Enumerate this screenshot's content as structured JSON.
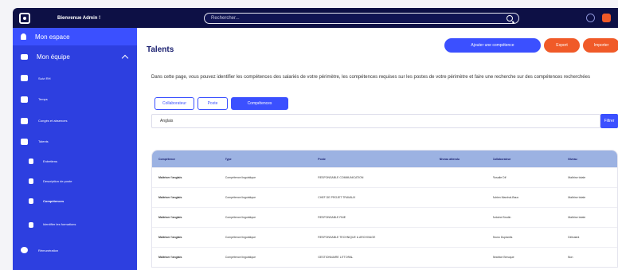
{
  "topbar": {
    "welcome": "Bienvenue Admin !",
    "search_placeholder": "Rechercher..."
  },
  "sidebar": {
    "my_space": "Mon espace",
    "my_team": "Mon équipe",
    "items": [
      {
        "label": "Suivi RH",
        "icon": "chart-icon"
      },
      {
        "label": "Temps",
        "icon": "car-icon"
      },
      {
        "label": "Congés et absences",
        "icon": "calendar-icon"
      },
      {
        "label": "Talents",
        "icon": "graduation-cap-icon"
      }
    ],
    "sub_items": [
      {
        "label": "Entretiens",
        "icon": "person-icon"
      },
      {
        "label": "Description de poste",
        "icon": "briefcase-icon"
      },
      {
        "label": "Compétences",
        "icon": "badge-icon",
        "active": true
      },
      {
        "label": "Identifier les formations",
        "icon": "star-icon"
      }
    ],
    "bottom_item": {
      "label": "Rémunération",
      "icon": "money-icon"
    }
  },
  "main": {
    "title": "Talents",
    "buttons": {
      "add": "Ajouter une compétence",
      "export": "Export",
      "import": "Importer"
    },
    "description": "Dans cette page, vous pouvez identifier les compétences des salariés de votre périmètre, les compétences requises sur les postes de votre périmètre et faire une recherche sur des compétences recherchées",
    "tabs": [
      "Collaborateur",
      "Poste",
      "Compétences"
    ],
    "search_value": "Anglais",
    "filter_label": "Filtrer"
  },
  "table": {
    "headers": [
      "Compétence",
      "Type",
      "Poste",
      "Niveau attendu",
      "Collaborateur",
      "Niveau"
    ],
    "rows": [
      [
        "Maîtriser l'anglais",
        "Compétence linguistique",
        "RESPONSABLE COMMUNICATION",
        "",
        "Rosalie Dif",
        "Maîtrise totale"
      ],
      [
        "Maîtriser l'anglais",
        "Compétence linguistique",
        "CHEF DE PROJET TRAVAUX",
        "",
        "Adrien Marchal-Bauc",
        "Maîtrise totale"
      ],
      [
        "Maîtriser l'anglais",
        "Compétence linguistique",
        "RESPONSABLE PAIE",
        "",
        "Antoine Brodin",
        "Maîtrise totale"
      ],
      [
        "Maîtriser l'anglais",
        "Compétence linguistique",
        "RESPONSABLE TECHNIQUE & ARCHIVAGE",
        "",
        "Bruno Duplantis",
        "Débutant"
      ],
      [
        "Maîtriser l'anglais",
        "Compétence linguistique",
        "GESTIONNAIRE LITTORAL",
        "",
        "Beatrice Breuque",
        "Bon"
      ]
    ]
  },
  "colors": {
    "topbar": "#0d1045",
    "sidebar": "#2d3fe0",
    "accent": "#3b50ff",
    "orange": "#f05a28"
  }
}
